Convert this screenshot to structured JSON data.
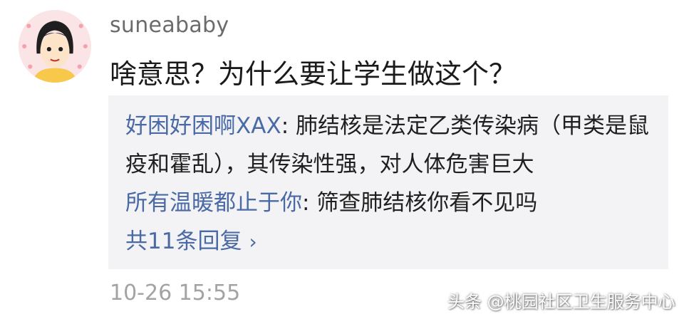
{
  "comment": {
    "username": "suneababy",
    "text": "啥意思？为什么要让学生做这个？",
    "timestamp": "10-26 15:55"
  },
  "replies": [
    {
      "author": "好困好困啊XAX",
      "sep": ": ",
      "text": "肺结核是法定乙类传染病（甲类是鼠疫和霍乱），其传染性强，对人体危害巨大"
    },
    {
      "author": "所有温暖都止于你",
      "sep": ": ",
      "text": "筛查肺结核你看不见吗"
    }
  ],
  "more_replies_label": "共11条回复",
  "watermark": "头条 @桃园社区卫生服务中心",
  "colors": {
    "link": "#4a6aa6",
    "reply_bg": "#f3f3f5",
    "username": "#6b6b6b",
    "timestamp": "#a3a3a3"
  }
}
